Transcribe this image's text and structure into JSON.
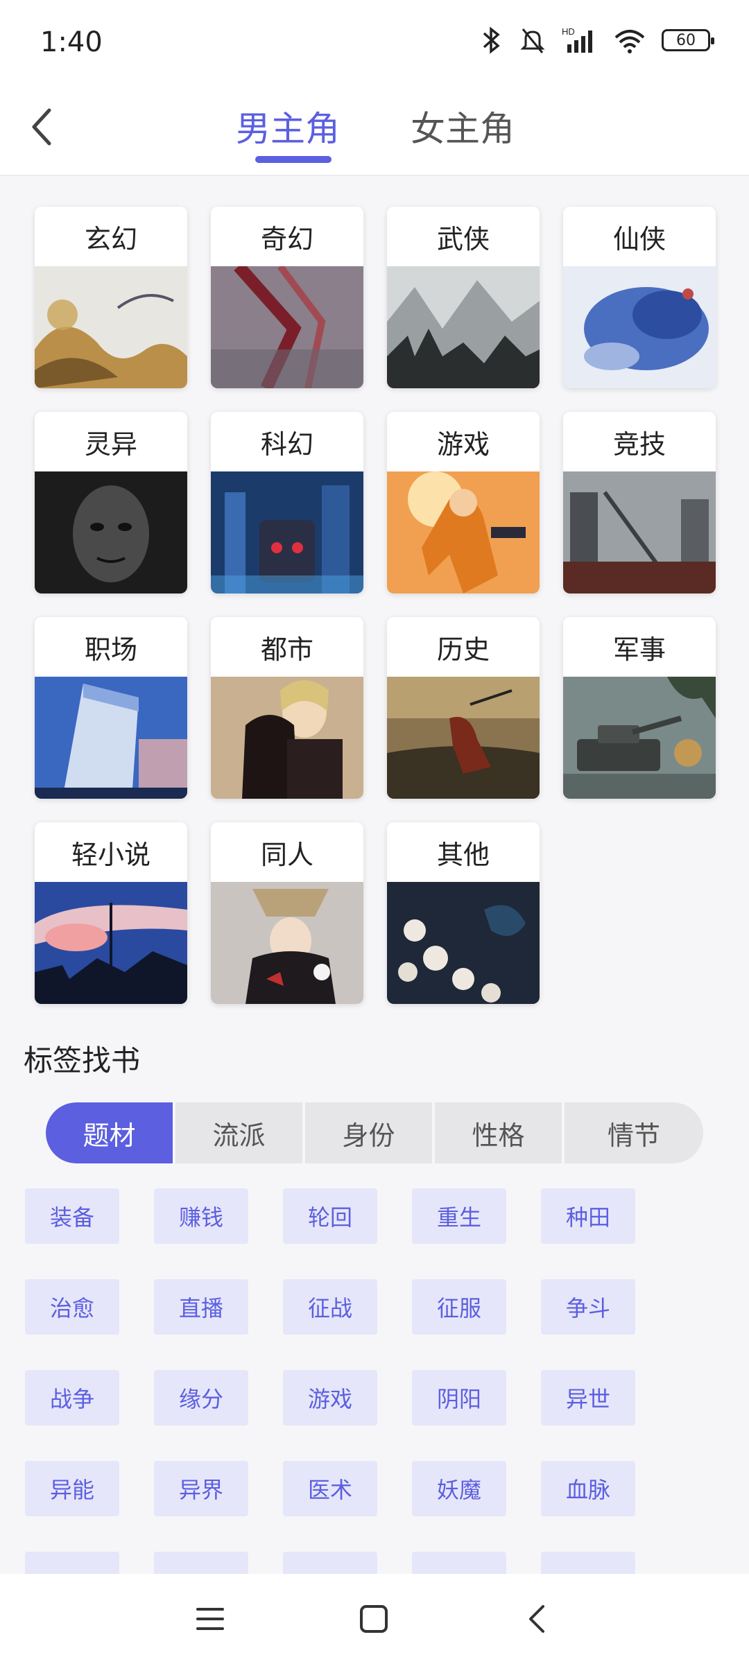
{
  "status": {
    "time": "1:40",
    "battery": "60",
    "network": "HD"
  },
  "header": {
    "tabs": [
      {
        "label": "男主角",
        "active": true
      },
      {
        "label": "女主角",
        "active": false
      }
    ]
  },
  "categories": [
    {
      "label": "玄幻"
    },
    {
      "label": "奇幻"
    },
    {
      "label": "武侠"
    },
    {
      "label": "仙侠"
    },
    {
      "label": "灵异"
    },
    {
      "label": "科幻"
    },
    {
      "label": "游戏"
    },
    {
      "label": "竞技"
    },
    {
      "label": "职场"
    },
    {
      "label": "都市"
    },
    {
      "label": "历史"
    },
    {
      "label": "军事"
    },
    {
      "label": "轻小说"
    },
    {
      "label": "同人"
    },
    {
      "label": "其他"
    }
  ],
  "tag_section": {
    "title": "标签找书",
    "filters": [
      {
        "label": "题材",
        "active": true
      },
      {
        "label": "流派"
      },
      {
        "label": "身份"
      },
      {
        "label": "性格"
      },
      {
        "label": "情节"
      }
    ],
    "tags": [
      "装备",
      "赚钱",
      "轮回",
      "重生",
      "种田",
      "治愈",
      "直播",
      "征战",
      "征服",
      "争斗",
      "战争",
      "缘分",
      "游戏",
      "阴阳",
      "异世",
      "异能",
      "异界",
      "医术",
      "妖魔",
      "血脉"
    ]
  },
  "colors": {
    "accent": "#5b5fe0",
    "tag_bg": "#e6e6fa",
    "background": "#f6f6f8"
  }
}
